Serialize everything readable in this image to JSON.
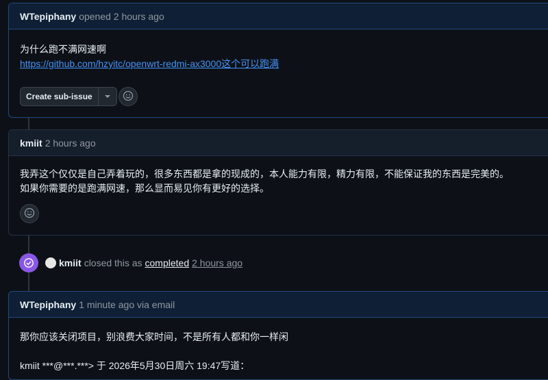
{
  "comment1": {
    "author": "WTepiphany",
    "meta": "opened 2 hours ago",
    "line1": "为什么跑不满网速啊",
    "link": "https://github.com/hzyitc/openwrt-redmi-ax3000这个可以跑满",
    "sub_issue_label": "Create sub-issue"
  },
  "comment2": {
    "author": "kmiit",
    "meta": "2 hours ago",
    "line1": "我弄这个仅仅是自己弄着玩的，很多东西都是拿的现成的，本人能力有限，精力有限，不能保证我的东西是完美的。",
    "line2": "如果你需要的是跑满网速，那么显而易见你有更好的选择。"
  },
  "event": {
    "actor": "kmiit",
    "text": "closed this as",
    "status": "completed",
    "time": "2 hours ago"
  },
  "comment3": {
    "author": "WTepiphany",
    "meta": "1 minute ago via email",
    "line1": "那你应该关闭项目，别浪费大家时间，不是所有人都和你一样闲",
    "quote": "kmiit ***@***.***> 于 2026年5月30日周六 19:47写道："
  },
  "colors": {
    "accent_purple": "#8957e5",
    "link_blue": "#4493f8",
    "background": "#0d1117"
  }
}
